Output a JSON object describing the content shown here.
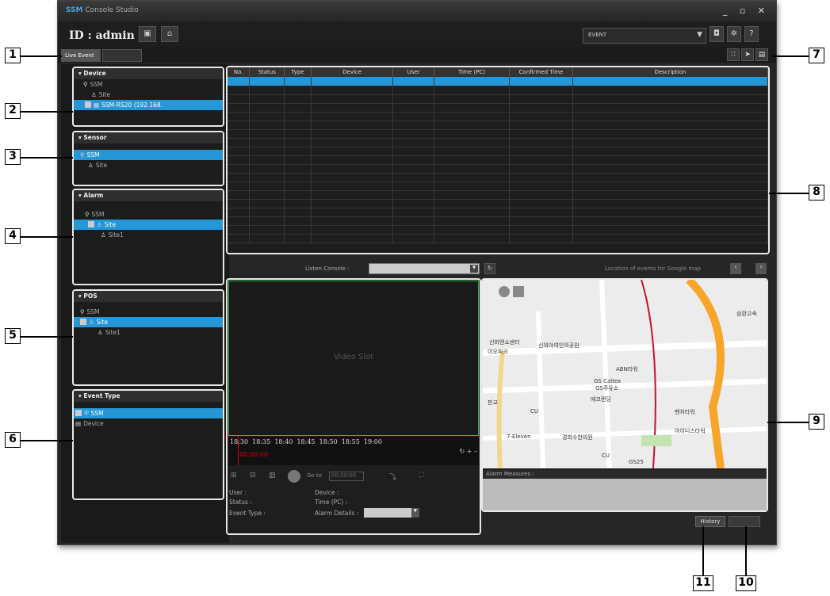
{
  "window": {
    "app_brand": "SSM",
    "app_title": "Console Studio",
    "controls": "_ ▫ ✕"
  },
  "header": {
    "user_id": "ID : admin",
    "event_dropdown": "EVENT"
  },
  "tabs": [
    {
      "label": "Live Event"
    },
    {
      "label": ""
    }
  ],
  "panels": {
    "device": {
      "title": "Device",
      "nodes": [
        "SSM",
        "Site",
        "SSM-RS20 (192.168."
      ]
    },
    "sensor": {
      "title": "Sensor",
      "nodes": [
        "SSM",
        "Site"
      ]
    },
    "alarm": {
      "title": "Alarm",
      "nodes": [
        "SSM",
        "Site",
        "Site1"
      ]
    },
    "pos": {
      "title": "POS",
      "nodes": [
        "SSM",
        "Site",
        "Site1"
      ]
    },
    "event_type": {
      "title": "Event Type",
      "nodes": [
        "SSM",
        "Device"
      ]
    }
  },
  "event_table": {
    "columns": [
      "No.",
      "Status",
      "Type",
      "Device",
      "User",
      "Time (PC)",
      "Confirmed Time",
      "Description"
    ]
  },
  "listen_bar": {
    "label": "Listen Console :",
    "location_text": "Location of events for Google map"
  },
  "video": {
    "placeholder": "Video Slot",
    "ticks": [
      "18:30",
      "18:35",
      "18:40",
      "18:45",
      "18:50",
      "18:55",
      "19:00"
    ],
    "current_time": "00:00:00",
    "goto_label": "Go to",
    "goto_value": "00:00:00"
  },
  "event_info": {
    "user": "User :",
    "device": "Device :",
    "status": "Status :",
    "time_pc": "Time (PC) :",
    "event_type": "Event Type :",
    "alarm_details": "Alarm Details :"
  },
  "map": {
    "alarm_measures": "Alarm Measures :",
    "labels": [
      "ABN타워",
      "GS Caltex",
      "GS주유소",
      "에코랜딩",
      "벤처타워",
      "CU",
      "7-Eleven",
      "아이디스타워",
      "경희수한의원",
      "CU",
      "GS25",
      "삼환고속",
      "신화엔쇼센터",
      "이오피크",
      "신의아여인의공원",
      "판교"
    ]
  },
  "buttons": {
    "history": "History"
  },
  "callouts": [
    "1",
    "2",
    "3",
    "4",
    "5",
    "6",
    "7",
    "8",
    "9",
    "10",
    "11"
  ]
}
